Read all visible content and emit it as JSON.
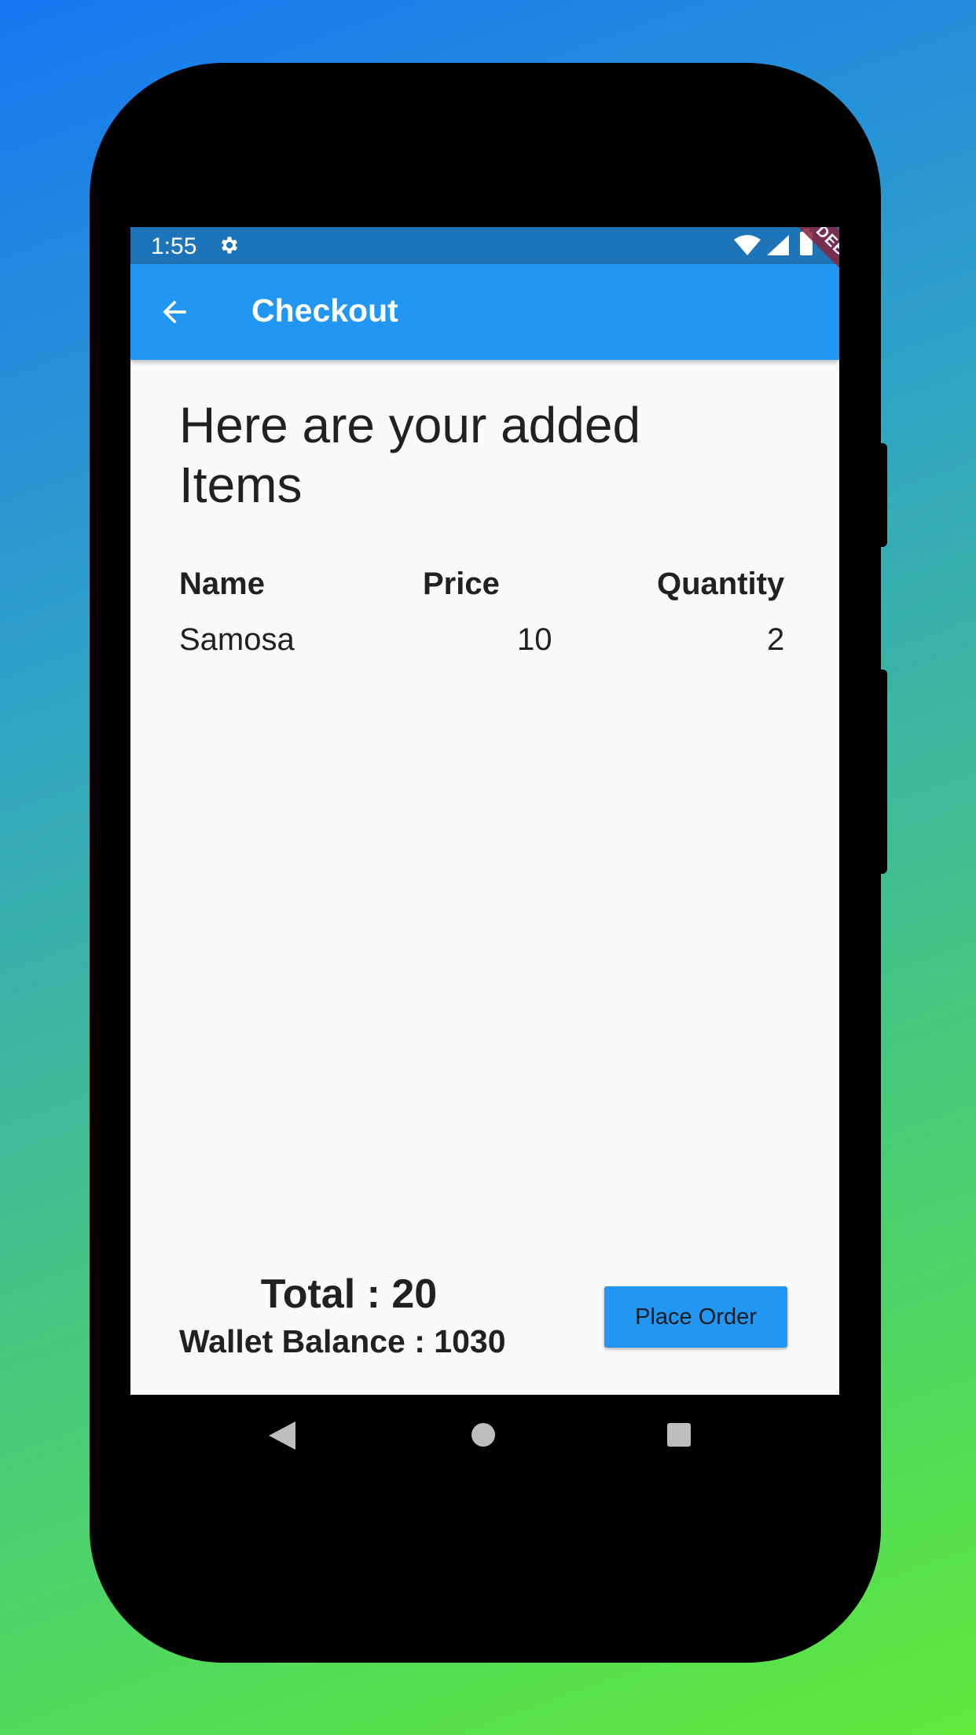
{
  "status_bar": {
    "time": "1:55"
  },
  "app_bar": {
    "title": "Checkout",
    "debug_label": "DEBUG"
  },
  "content": {
    "heading": "Here are your added Items",
    "table": {
      "headers": [
        "Name",
        "Price",
        "Quantity"
      ],
      "rows": [
        [
          "Samosa",
          "10",
          "2"
        ]
      ]
    },
    "total": "Total : 20",
    "wallet_balance": "Wallet Balance : 1030",
    "place_order_label": "Place Order"
  },
  "colors": {
    "primary": "#2196f3",
    "status_bar": "#1e74b8",
    "background": "#fafafa",
    "text": "#212121"
  },
  "icons": [
    "settings-icon",
    "wifi-icon",
    "signal-icon",
    "battery-icon",
    "back-arrow-icon",
    "nav-back-icon",
    "nav-home-icon",
    "nav-recents-icon"
  ]
}
